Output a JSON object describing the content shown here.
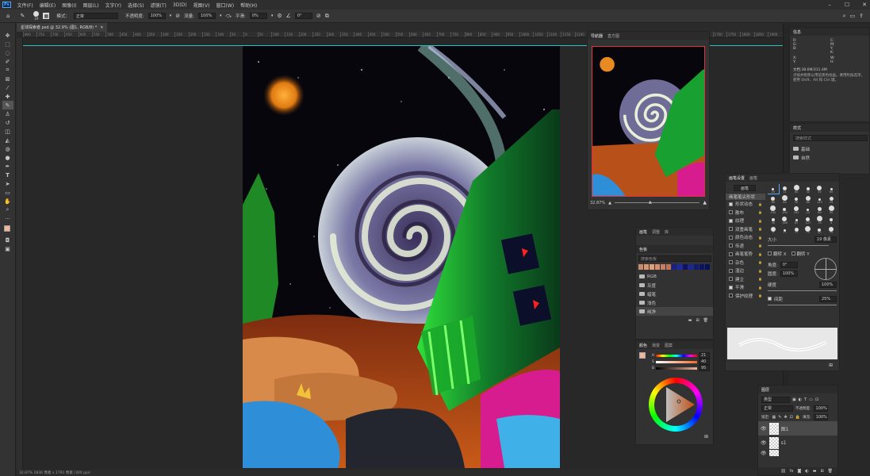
{
  "menubar": {
    "logo": "Ps",
    "items": [
      "文件(F)",
      "编辑(E)",
      "图像(I)",
      "图层(L)",
      "文字(Y)",
      "选择(S)",
      "滤镜(T)",
      "3D(D)",
      "视图(V)",
      "窗口(W)",
      "帮助(H)"
    ]
  },
  "options": {
    "brush_size": "19",
    "mode_label": "模式：",
    "mode_value": "正常",
    "opacity_label": "不透明度:",
    "opacity_value": "100%",
    "flow_label": "流量:",
    "flow_value": "100%",
    "smooth_label": "平滑:",
    "smooth_value": "0%",
    "angle_value": "0°"
  },
  "document": {
    "tab_title": "星球探索者.psd @ 32.9% (图1, RGB/8) *",
    "ruler_ticks": [
      "800",
      "750",
      "700",
      "650",
      "600",
      "550",
      "500",
      "450",
      "400",
      "350",
      "300",
      "250",
      "200",
      "150",
      "100",
      "50",
      "0",
      "50",
      "100",
      "150",
      "200",
      "250",
      "300",
      "350",
      "400",
      "450",
      "500",
      "550",
      "600",
      "650",
      "700",
      "750",
      "800",
      "850",
      "900",
      "950",
      "1000",
      "1050",
      "1100",
      "1150",
      "1200",
      "1250",
      "1300",
      "1350",
      "1400",
      "1450",
      "1500",
      "1550",
      "1600",
      "1650",
      "1700",
      "1750",
      "1800",
      "1850",
      "1900"
    ],
    "status": "32.87%    2836 像素 x 1791 像素 (300 ppi)"
  },
  "navigator": {
    "tabs": [
      "导航器",
      "直方图"
    ],
    "zoom": "32.87%"
  },
  "info": {
    "title": "信息",
    "rgb": [
      "R:",
      "G:",
      "B:"
    ],
    "cmyk": [
      "C:",
      "M:",
      "Y:",
      "K:"
    ],
    "xy": [
      "X:",
      "Y:"
    ],
    "wh": [
      "W:",
      "H:"
    ],
    "doc": "文档:38.6M/311.4M",
    "hint": "点按并拖移以用前景色绘画。要用附加选项，使用 Shift、Alt 和 Ctrl 键。"
  },
  "styles": {
    "title": "样式",
    "search_placeholder": "搜索样式",
    "groups": [
      "基础",
      "自然"
    ]
  },
  "swatches": {
    "tabs": [
      "画笔",
      "调整",
      "库"
    ],
    "title": "色板",
    "search_placeholder": "搜索色板",
    "colors": [
      "#c98a6c",
      "#d69572",
      "#e0a07a",
      "#d58f6e",
      "#c77f62",
      "#b97558",
      "#1c1c8c",
      "#1a2aa0",
      "#101070",
      "#182890",
      "#0d1a78",
      "#0a1466",
      "#081058"
    ],
    "groups": [
      "RGB",
      "灰度",
      "蜡笔",
      "浅色",
      "纯净"
    ]
  },
  "color": {
    "tabs": [
      "颜色",
      "渐变",
      "图案"
    ],
    "labels": [
      "H",
      "S",
      "B"
    ],
    "values": [
      "21",
      "40",
      "95"
    ],
    "fg": "#f2b59a",
    "bg": "#ffffff"
  },
  "brush_settings": {
    "tabs": [
      "画笔设置",
      "画笔"
    ],
    "brush_button": "画笔",
    "tip_shape": "画笔笔尖形状",
    "options": [
      {
        "label": "形状动态",
        "checked": true
      },
      {
        "label": "散布",
        "checked": false
      },
      {
        "label": "纹理",
        "checked": true
      },
      {
        "label": "双重画笔",
        "checked": false
      },
      {
        "label": "颜色动态",
        "checked": false
      },
      {
        "label": "传递",
        "checked": false
      },
      {
        "label": "画笔笔势",
        "checked": false
      },
      {
        "label": "杂色",
        "checked": false
      },
      {
        "label": "湿边",
        "checked": false
      },
      {
        "label": "建立",
        "checked": false
      },
      {
        "label": "平滑",
        "checked": true
      },
      {
        "label": "保护纹理",
        "checked": false
      }
    ],
    "tip_sizes": [
      "25",
      "11",
      "60",
      "30",
      "30",
      "60",
      "65",
      "60",
      "30",
      "60",
      "123",
      "25",
      "100",
      "100",
      "102",
      "15",
      "80",
      "50",
      "30",
      "188",
      "87",
      "127",
      "19",
      "4",
      "3",
      "12",
      "21",
      "15",
      "60",
      "25",
      "45"
    ],
    "size_label": "大小",
    "size_value": "19 像素",
    "flip_x": "翻转 X",
    "flip_y": "翻转 Y",
    "angle_label": "角度:",
    "angle_value": "0°",
    "roundness_label": "圆度:",
    "roundness_value": "100%",
    "hardness_label": "硬度",
    "hardness_value": "100%",
    "spacing_label": "间距",
    "spacing_value": "25%"
  },
  "layers": {
    "title": "图层",
    "filter_type": "类型",
    "blend_mode": "正常",
    "opacity_label": "不透明度:",
    "opacity_value": "100%",
    "lock_label": "锁定:",
    "fill_label": "填充:",
    "fill_value": "100%",
    "items": [
      "图1",
      "s1",
      ""
    ]
  }
}
